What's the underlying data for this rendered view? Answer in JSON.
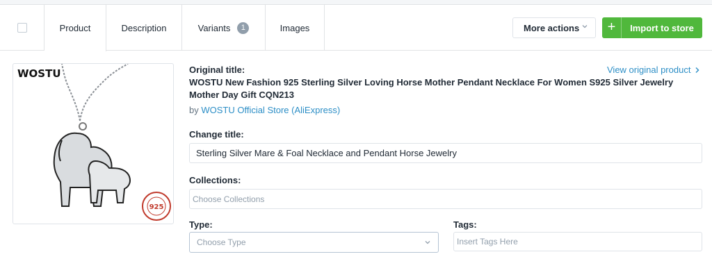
{
  "tabs": {
    "product": "Product",
    "description": "Description",
    "variants": "Variants",
    "variants_count": "1",
    "images": "Images"
  },
  "actions": {
    "more_actions": "More actions",
    "import_to_store": "Import to store"
  },
  "product": {
    "image_brand": "WOSTU",
    "image_stamp_text": "925",
    "original_title_label": "Original title:",
    "original_title": "WOSTU New Fashion 925 Sterling Silver Loving Horse Mother Pendant Necklace For Women S925 Silver Jewelry Mother Day Gift CQN213",
    "by_prefix": "by",
    "store_link": "WOSTU Official Store (AliExpress)",
    "view_original": "View original product"
  },
  "form": {
    "change_title_label": "Change title:",
    "change_title_value": "Sterling Silver Mare & Foal Necklace and Pendant Horse Jewelry",
    "collections_label": "Collections:",
    "collections_placeholder": "Choose Collections",
    "type_label": "Type:",
    "type_placeholder": "Choose Type",
    "tags_label": "Tags:",
    "tags_placeholder": "Insert Tags Here"
  },
  "colors": {
    "accent_blue": "#2c8ec6",
    "import_green": "#50b83c",
    "border": "#dfe3e8"
  }
}
